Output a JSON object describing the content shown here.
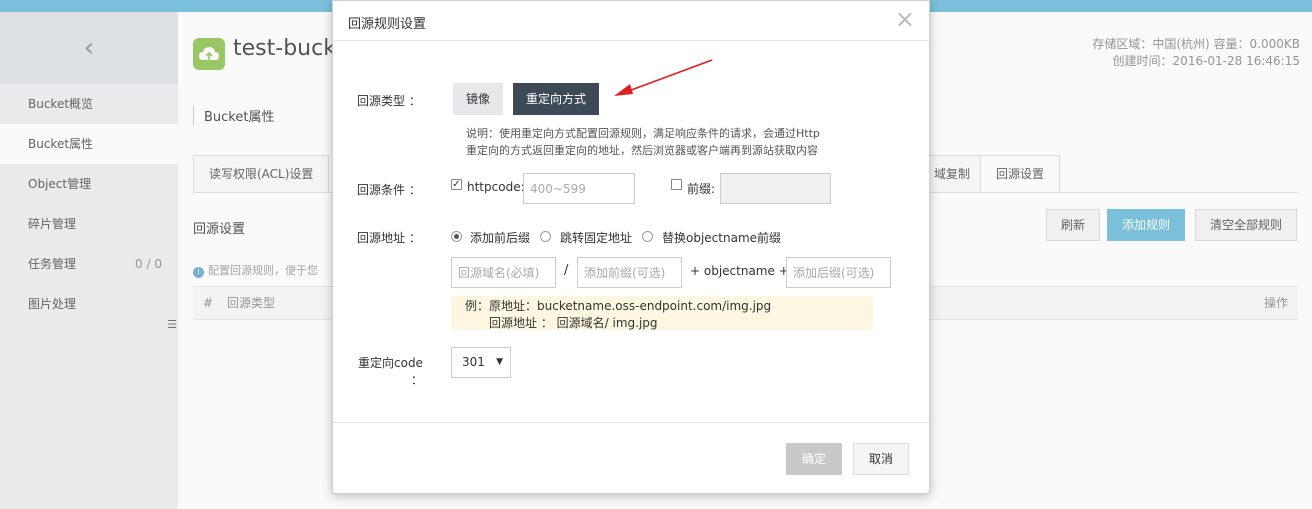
{
  "sidebar": {
    "back_glyph": "‹",
    "items": [
      {
        "label": "Bucket概览"
      },
      {
        "label": "Bucket属性"
      },
      {
        "label": "Object管理"
      },
      {
        "label": "碎片管理"
      },
      {
        "label": "任务管理",
        "count": "0 / 0"
      },
      {
        "label": "图片处理"
      }
    ]
  },
  "header": {
    "bucket_name": "test-buck",
    "region_line": "存储区域：中国(杭州)    容量：0.000KB",
    "created_line": "创建时间：2016-01-28 16:46:15"
  },
  "main": {
    "section_title": "Bucket属性",
    "tabs": [
      {
        "label": "读写权限(ACL)设置"
      },
      {
        "label": "域复制"
      },
      {
        "label": "回源设置"
      }
    ],
    "sub_title": "回源设置",
    "buttons": {
      "refresh": "刷新",
      "add_rule": "添加规则",
      "clear_all": "清空全部规则"
    },
    "hint": "配置回源规则，便于您",
    "table_headers": {
      "index": "#",
      "type": "回源类型",
      "actions": "操作"
    }
  },
  "modal": {
    "title": "回源规则设置",
    "close_glyph": "×",
    "type_label": "回源类型 ：",
    "type_options": {
      "mirror": "镜像",
      "redirect": "重定向方式"
    },
    "desc_line1": "说明：使用重定向方式配置回源规则，满足响应条件的请求，会通过Http",
    "desc_line2": "重定向的方式返回重定向的地址，然后浏览器或客户端再到源站获取内容",
    "condition_label": "回源条件 ：",
    "httpcode_label": "httpcode:",
    "httpcode_placeholder": "400~599",
    "prefix_label": "前缀:",
    "address_label": "回源地址 ：",
    "address_options": [
      {
        "label": "添加前后缀",
        "checked": true
      },
      {
        "label": "跳转固定地址",
        "checked": false
      },
      {
        "label": "替换objectname前缀",
        "checked": false
      }
    ],
    "domain_placeholder": "回源域名(必填)",
    "slash": "/",
    "prefix_placeholder": "添加前缀(可选)",
    "objectname_text": "+ objectname +",
    "suffix_placeholder": "添加后缀(可选)",
    "example_line1": "例：原地址：bucketname.oss-endpoint.com/img.jpg",
    "example_line2": "回源地址 ： 回源域名/ img.jpg",
    "code_label_line1": "重定向code",
    "code_label_line2": "：",
    "code_value": "301",
    "caret_glyph": "▼",
    "confirm": "确定",
    "cancel": "取消"
  },
  "colors": {
    "accent": "#7ec4df",
    "annotation_arrow": "#e02020",
    "redirect_button": "#3d4a56"
  }
}
